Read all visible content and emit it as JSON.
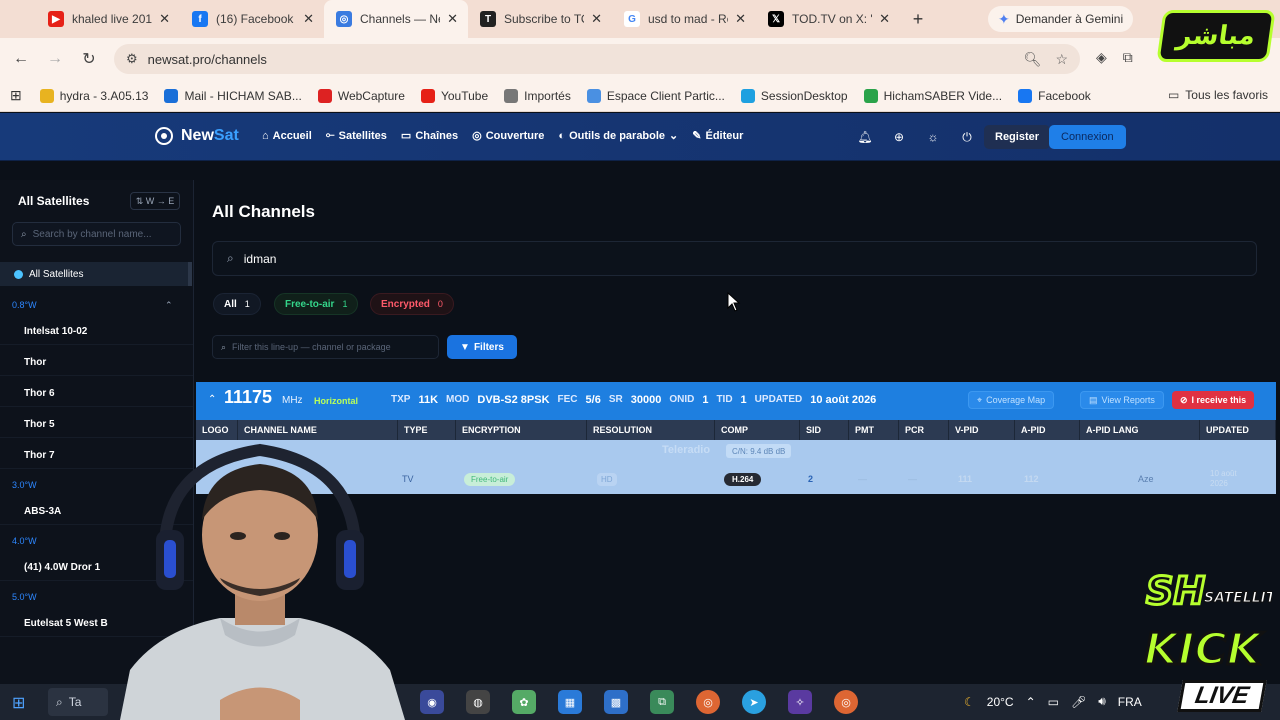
{
  "browser": {
    "tabs": [
      {
        "title": "khaled live 201",
        "color": "#e62117",
        "glyph": "▶"
      },
      {
        "title": "(16) Facebook",
        "color": "#1877f2",
        "glyph": "f"
      },
      {
        "title": "Channels — Ne",
        "color": "#3a7be0",
        "glyph": "◎",
        "active": true
      },
      {
        "title": "Subscribe to TO",
        "color": "#222",
        "glyph": "T"
      },
      {
        "title": "usd to mad - Re",
        "color": "#ffffff",
        "glyph": "G"
      },
      {
        "title": "TOD.TV on X: \"",
        "color": "#000",
        "glyph": "𝕏"
      }
    ],
    "gemini_label": "Demander à Gemini",
    "url": "newsat.pro/channels",
    "bookmarks": [
      {
        "label": "hydra - 3.A05.13",
        "color": "#e8b320"
      },
      {
        "label": "Mail - HICHAM SAB...",
        "color": "#1a6fd8"
      },
      {
        "label": "WebCapture",
        "color": "#d22"
      },
      {
        "label": "YouTube",
        "color": "#e62117"
      },
      {
        "label": "Importés",
        "color": "#777"
      },
      {
        "label": "Espace Client Partic...",
        "color": "#4a90e2"
      },
      {
        "label": "SessionDesktop",
        "color": "#1ea0e0"
      },
      {
        "label": "HichamSABER Vide...",
        "color": "#2aa34a"
      },
      {
        "label": "Facebook",
        "color": "#1877f2"
      }
    ],
    "all_bookmarks": "Tous les favoris"
  },
  "site": {
    "logo_new": "New",
    "logo_sat": "Sat",
    "menu": [
      "Accueil",
      "Satellites",
      "Chaînes",
      "Couverture",
      "Outils de parabole",
      "Éditeur"
    ],
    "register": "Register",
    "login": "Connexion"
  },
  "sidebar": {
    "title": "All Satellites",
    "sort": "W → E",
    "search_placeholder": "Search by channel name...",
    "all": "All Satellites",
    "groups": [
      {
        "label": "0.8°W",
        "items": [
          "Intelsat 10-02",
          "Thor",
          "Thor 6",
          "Thor 5",
          "Thor 7"
        ]
      },
      {
        "label": "3.0°W",
        "items": [
          "ABS-3A"
        ]
      },
      {
        "label": "4.0°W",
        "items": [
          "(41) 4.0W Dror 1"
        ]
      },
      {
        "label": "5.0°W",
        "items": [
          "Eutelsat 5 West B"
        ]
      }
    ]
  },
  "main": {
    "title": "All Channels",
    "search_value": "idman",
    "pills": {
      "all_label": "All",
      "all_count": "1",
      "free_label": "Free-to-air",
      "free_count": "1",
      "enc_label": "Encrypted",
      "enc_count": "0"
    },
    "filter_placeholder": "Filter this line-up — channel or package",
    "filters_button": "Filters"
  },
  "transponder": {
    "freq": "11175",
    "unit": "MHz",
    "polarization": "Horizontal",
    "params": [
      {
        "k": "TXP",
        "v": "11K"
      },
      {
        "k": "MOD",
        "v": "DVB-S2 8PSK"
      },
      {
        "k": "FEC",
        "v": "5/6"
      },
      {
        "k": "SR",
        "v": "30000"
      },
      {
        "k": "ONID",
        "v": "1"
      },
      {
        "k": "TID",
        "v": "1"
      },
      {
        "k": "UPDATED",
        "v": "10 août 2026"
      }
    ],
    "coverage_btn": "Coverage Map",
    "reports_btn": "View Reports",
    "receive_btn": "I receive this",
    "columns": [
      "LOGO",
      "CHANNEL NAME",
      "TYPE",
      "ENCRYPTION",
      "RESOLUTION",
      "COMP",
      "SID",
      "PMT",
      "PCR",
      "V-PID",
      "A-PID",
      "A-PID LANG",
      "UPDATED"
    ],
    "provider": "Teleradio",
    "cn": "C/N: 9.4 dB dB",
    "row": {
      "type": "TV",
      "encryption": "Free-to-air",
      "resolution": "HD",
      "comp": "H.264",
      "sid": "2",
      "pmt": "—",
      "pcr": "—",
      "vpid": "111",
      "apid": "112",
      "lang": "Aze",
      "updated": "10 août 2026"
    }
  },
  "taskbar": {
    "search": "Ta",
    "temp": "20°C",
    "lang": "FRA"
  },
  "overlays": {
    "mubasher": "مباشر",
    "kick_sh": "SH",
    "kick_satellite": "SATELLITE",
    "kick": "KICK",
    "live": "LIVE"
  }
}
